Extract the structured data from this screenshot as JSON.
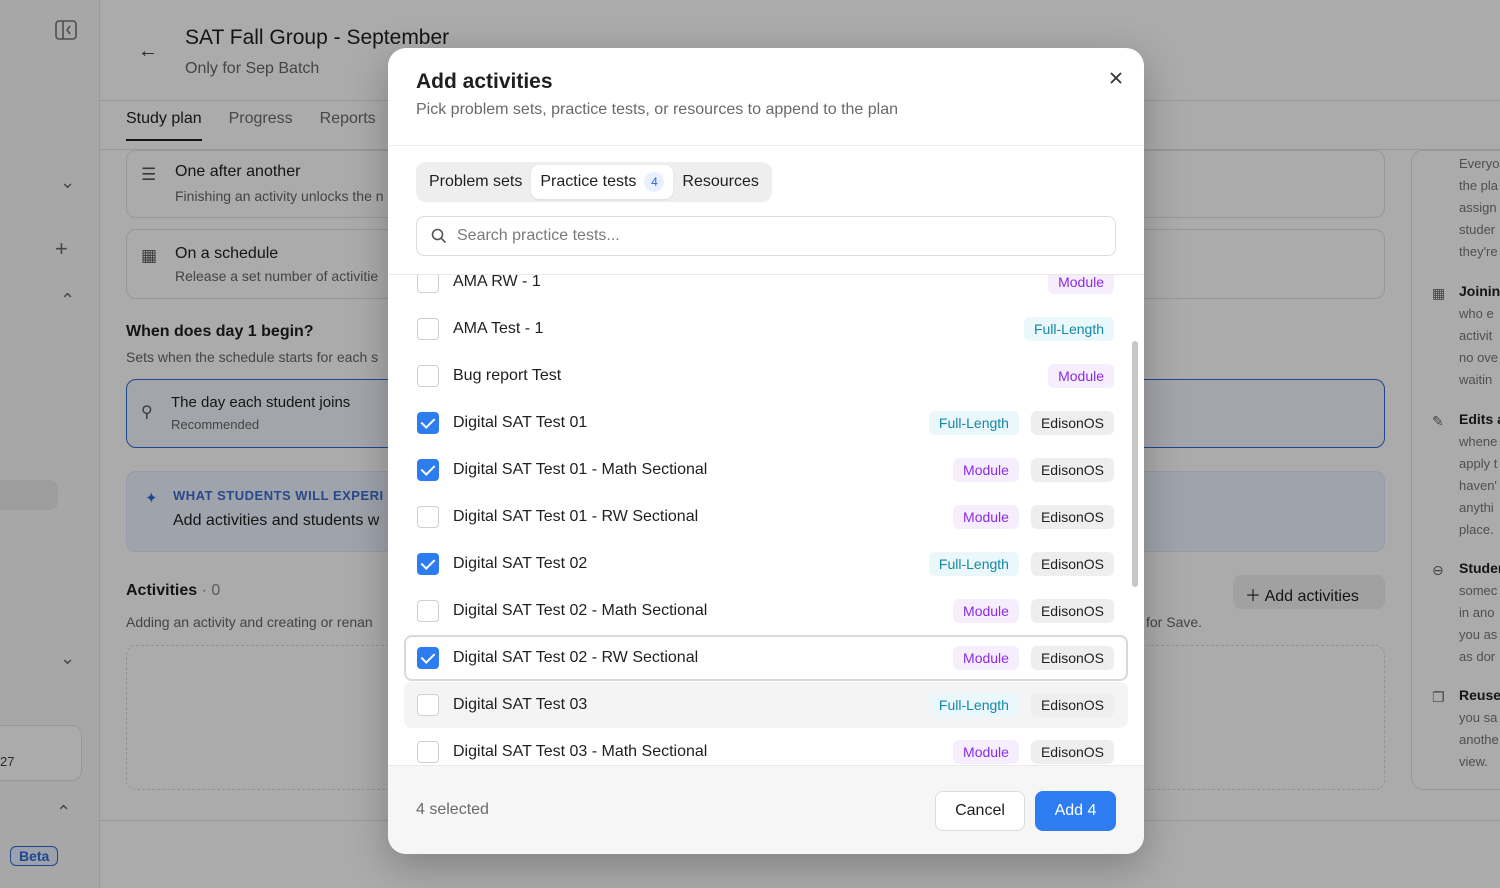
{
  "app": {
    "title": "SAT Fall Group - September",
    "subtitle": "Only for Sep Batch",
    "tabs": [
      "Study plan",
      "Progress",
      "Reports"
    ],
    "rail_card_text": "27",
    "beta": "Beta"
  },
  "background": {
    "one_after_title": "One after another",
    "one_after_desc": "Finishing an activity unlocks the n",
    "schedule_title": "On a schedule",
    "schedule_desc": "Release a set number of activitie",
    "day1_heading": "When does day 1 begin?",
    "day1_desc": "Sets when the schedule starts for each s",
    "join_title": "The day each student joins",
    "join_desc": "Recommended",
    "info_heading": "WHAT STUDENTS WILL EXPERI",
    "info_text": "Add activities and students w",
    "activities_heading": "Activities",
    "activities_count": " · 0",
    "activities_desc": "Adding an activity and creating or renan",
    "activities_desc_right": "for Save.",
    "add_activities": "Add activities"
  },
  "right_panel": {
    "block1": [
      "Everyo",
      "the pla",
      "assign",
      "studer",
      "they're"
    ],
    "block2_head": "Joinin",
    "block2": [
      "who e",
      "activit",
      "no ove",
      "waitin"
    ],
    "block3_head": "Edits a",
    "block3": [
      "whene",
      "apply t",
      "haven'",
      "anythi",
      "place."
    ],
    "block4_head": "Studer",
    "block4": [
      "somec",
      "in ano",
      "you as",
      "as dor"
    ],
    "block5_head": "Reuse",
    "block5": [
      "you sa",
      "anothe",
      "view."
    ]
  },
  "modal": {
    "title": "Add activities",
    "subtitle": "Pick problem sets, practice tests, or resources to append to the plan",
    "tabs": [
      {
        "label": "Problem sets"
      },
      {
        "label": "Practice tests",
        "badge": "4"
      },
      {
        "label": "Resources"
      }
    ],
    "search_placeholder": "Search practice tests...",
    "items": [
      {
        "label": "AMA RW - 1",
        "checked": false,
        "tags": [
          {
            "text": "Module",
            "kind": "module"
          }
        ]
      },
      {
        "label": "AMA Test - 1",
        "checked": false,
        "tags": [
          {
            "text": "Full-Length",
            "kind": "full"
          }
        ]
      },
      {
        "label": "Bug report Test",
        "checked": false,
        "tags": [
          {
            "text": "Module",
            "kind": "module"
          }
        ]
      },
      {
        "label": "Digital SAT Test 01",
        "checked": true,
        "tags": [
          {
            "text": "Full-Length",
            "kind": "full"
          },
          {
            "text": "EdisonOS",
            "kind": "source"
          }
        ]
      },
      {
        "label": "Digital SAT Test 01 - Math Sectional",
        "checked": true,
        "tags": [
          {
            "text": "Module",
            "kind": "module"
          },
          {
            "text": "EdisonOS",
            "kind": "source"
          }
        ]
      },
      {
        "label": "Digital SAT Test 01 - RW Sectional",
        "checked": false,
        "tags": [
          {
            "text": "Module",
            "kind": "module"
          },
          {
            "text": "EdisonOS",
            "kind": "source"
          }
        ]
      },
      {
        "label": "Digital SAT Test 02",
        "checked": true,
        "tags": [
          {
            "text": "Full-Length",
            "kind": "full"
          },
          {
            "text": "EdisonOS",
            "kind": "source"
          }
        ]
      },
      {
        "label": "Digital SAT Test 02 - Math Sectional",
        "checked": false,
        "tags": [
          {
            "text": "Module",
            "kind": "module"
          },
          {
            "text": "EdisonOS",
            "kind": "source"
          }
        ]
      },
      {
        "label": "Digital SAT Test 02 - RW Sectional",
        "checked": true,
        "state": "focused",
        "tags": [
          {
            "text": "Module",
            "kind": "module"
          },
          {
            "text": "EdisonOS",
            "kind": "source"
          }
        ]
      },
      {
        "label": "Digital SAT Test 03",
        "checked": false,
        "state": "hover",
        "tags": [
          {
            "text": "Full-Length",
            "kind": "full"
          },
          {
            "text": "EdisonOS",
            "kind": "source"
          }
        ]
      },
      {
        "label": "Digital SAT Test 03 - Math Sectional",
        "checked": false,
        "tags": [
          {
            "text": "Module",
            "kind": "module"
          },
          {
            "text": "EdisonOS",
            "kind": "source"
          }
        ]
      }
    ],
    "selected_count": "4 selected",
    "cancel": "Cancel",
    "add": "Add 4"
  },
  "colors": {
    "accent": "#2d7cf0",
    "module_tag": "#8a2be2",
    "full_tag": "#1488a6"
  },
  "icons": {
    "close": "close-icon",
    "search": "search-icon",
    "back": "arrow-left-icon"
  }
}
